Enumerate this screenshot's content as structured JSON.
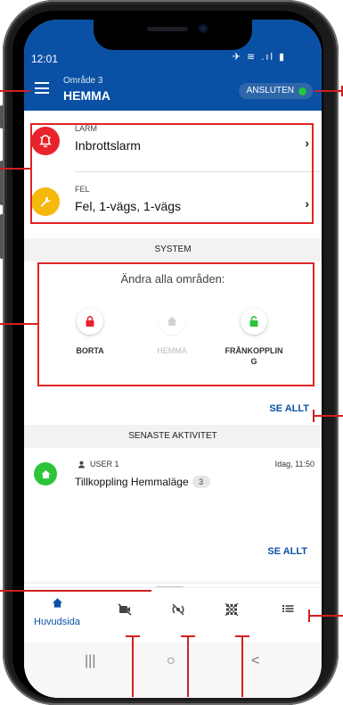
{
  "status_bar": {
    "time": "12:01",
    "icons": "✈ ≋ .ıl ▮"
  },
  "app_bar": {
    "menu_icon": "hamburger-icon",
    "area_label": "Område 3",
    "area_name": "HEMMA",
    "connection_status": "ANSLUTEN",
    "connection_color": "#22c43a"
  },
  "alerts": [
    {
      "category": "LARM",
      "title": "Inbrottslarm",
      "icon": "alarm-bell-icon",
      "color": "#e8232b"
    },
    {
      "category": "FEL",
      "title": "Fel, 1-vägs, 1-vägs",
      "icon": "wrench-icon",
      "color": "#f5b80b"
    }
  ],
  "system": {
    "header": "SYSTEM",
    "change_all_label": "Ändra alla områden:",
    "modes": [
      {
        "label": "BORTA",
        "icon": "lock-closed-icon",
        "color": "#e8232b",
        "enabled": true
      },
      {
        "label": "HEMMA",
        "icon": "house-icon",
        "color": "#cccccc",
        "enabled": false
      },
      {
        "label": "FRÅNKOPPLIN\nG",
        "icon": "lock-open-icon",
        "color": "#2dc43a",
        "enabled": true
      }
    ],
    "see_all": "SE ALLT"
  },
  "activity": {
    "header": "SENASTE AKTIVITET",
    "items": [
      {
        "user": "USER 1",
        "time": "Idag, 11:50",
        "title": "Tillkoppling Hemmaläge",
        "count": "3",
        "icon": "house-icon"
      }
    ],
    "see_all": "SE ALLT"
  },
  "bottom_nav": {
    "home_label": "Huvudsida",
    "items": [
      "home-icon",
      "camera-off-icon",
      "sensor-icon",
      "grid-off-icon",
      "list-icon"
    ],
    "accent": "#0a51a5"
  },
  "system_nav": [
    "|||",
    "○",
    "<"
  ],
  "colors": {
    "brand": "#0a51a5",
    "annotation": "#e02424"
  }
}
